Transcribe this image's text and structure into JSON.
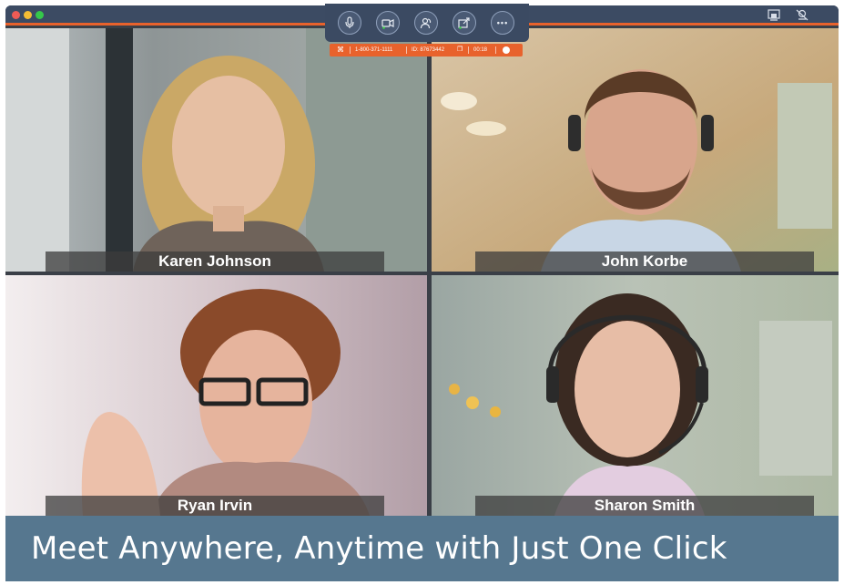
{
  "window": {
    "traffic_lights": [
      "close",
      "minimize",
      "maximize"
    ],
    "right_icons": [
      "screen-layout-icon",
      "camera-off-icon"
    ]
  },
  "toolbar": {
    "buttons": [
      {
        "icon": "microphone-icon"
      },
      {
        "icon": "video-camera-icon"
      },
      {
        "icon": "participants-icon"
      },
      {
        "icon": "share-screen-icon"
      },
      {
        "icon": "more-icon",
        "label": "•••"
      }
    ]
  },
  "meeting_info": {
    "phone": "1-800-371-1111",
    "meeting_id": "ID: 87673442",
    "duration": "00:18"
  },
  "participants": [
    {
      "name": "Karen Johnson"
    },
    {
      "name": "John Korbe"
    },
    {
      "name": "Ryan Irvin"
    },
    {
      "name": "Sharon Smith"
    }
  ],
  "banner": {
    "headline": "Meet Anywhere, Anytime with Just One Click"
  },
  "colors": {
    "accent": "#e8622c",
    "titlebar": "#3c4b63",
    "banner": "#56778f"
  }
}
